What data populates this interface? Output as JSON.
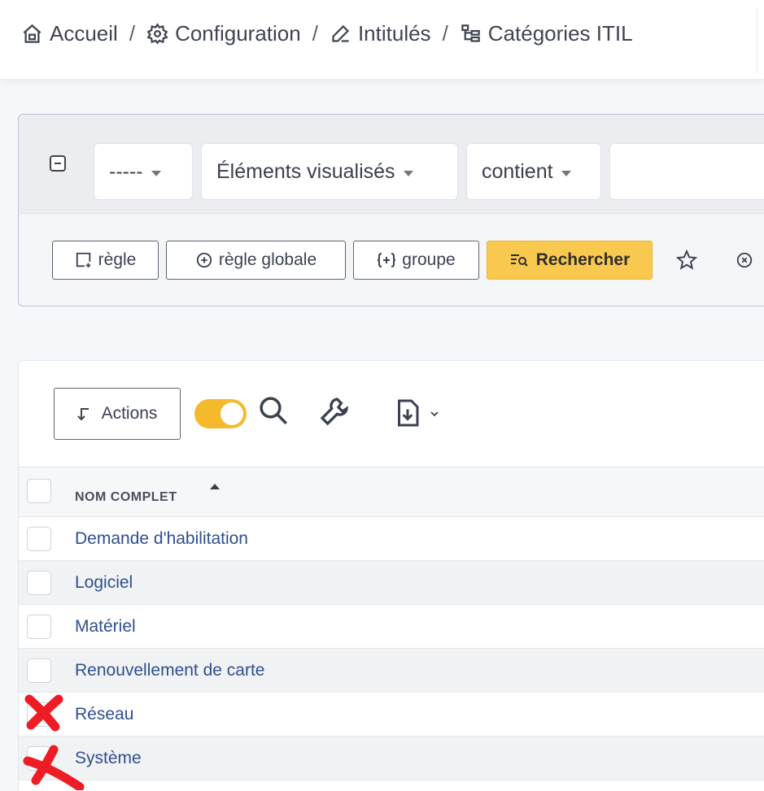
{
  "breadcrumb": [
    {
      "label": "Accueil",
      "icon": "home-icon"
    },
    {
      "label": "Configuration",
      "icon": "gear-icon"
    },
    {
      "label": "Intitulés",
      "icon": "edit-icon"
    },
    {
      "label": "Catégories ITIL",
      "icon": "tree-icon"
    }
  ],
  "breadcrumb_separator": "/",
  "search": {
    "field_select": "-----",
    "view_select": "Éléments visualisés",
    "operator_select": "contient",
    "value": "",
    "buttons": {
      "rule": "règle",
      "global_rule": "règle globale",
      "group": "groupe",
      "search": "Rechercher"
    }
  },
  "list": {
    "actions_label": "Actions",
    "toggle_on": true,
    "column_header": "NOM COMPLET",
    "rows": [
      {
        "name": "Demande d'habilitation"
      },
      {
        "name": "Logiciel"
      },
      {
        "name": "Matériel"
      },
      {
        "name": "Renouvellement de carte"
      },
      {
        "name": "Réseau"
      },
      {
        "name": "Système"
      }
    ]
  },
  "colors": {
    "accent_yellow": "#f9c84e",
    "link_blue": "#2f4f8f",
    "annotation_red": "#ee1c24"
  }
}
